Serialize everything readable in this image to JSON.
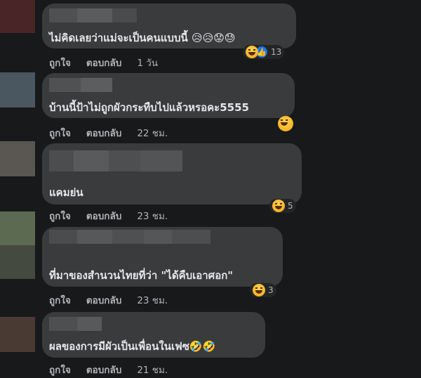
{
  "comments": [
    {
      "text": "ไม่คิดเลยว่าแม่จะเป็นคนแบบนี้ 😥😥😟😓",
      "like": "ถูกใจ",
      "reply": "ตอบกลับ",
      "time": "1 วัน",
      "reaction_icons": [
        "laugh-emoji",
        "like-icon"
      ],
      "reaction_count": "13",
      "avatar_color": "#4a2528"
    },
    {
      "text": "บ้านนี้ป้าไม่ถูกผัวกระทืบไปแล้วหรอคะ5555",
      "like": "ถูกใจ",
      "reply": "ตอบกลับ",
      "time": "22 ชม.",
      "reaction_icons": [
        "laugh-emoji"
      ],
      "reaction_count": "",
      "avatar_color": "#4a5660"
    },
    {
      "text": "แคมย่น",
      "like": "ถูกใจ",
      "reply": "ตอบกลับ",
      "time": "23 ชม.",
      "reaction_icons": [
        "laugh-emoji"
      ],
      "reaction_count": "5",
      "avatar_color": "#5a5753"
    },
    {
      "text": "ที่มาของสำนวนไทยที่ว่า \"ได้คืบเอาศอก\"",
      "like": "ถูกใจ",
      "reply": "ตอบกลับ",
      "time": "23 ชม.",
      "reaction_icons": [
        "laugh-emoji"
      ],
      "reaction_count": "3",
      "avatar_color": "#5d6a52"
    },
    {
      "text": "ผลของการมีผัวเป็นเพื่อนในเฟซ🤣🤣",
      "like": "ถูกใจ",
      "reply": "ตอบกลับ",
      "time": "21 ชม.",
      "reaction_icons": [],
      "reaction_count": "",
      "avatar_color": "#4a3a34"
    }
  ]
}
